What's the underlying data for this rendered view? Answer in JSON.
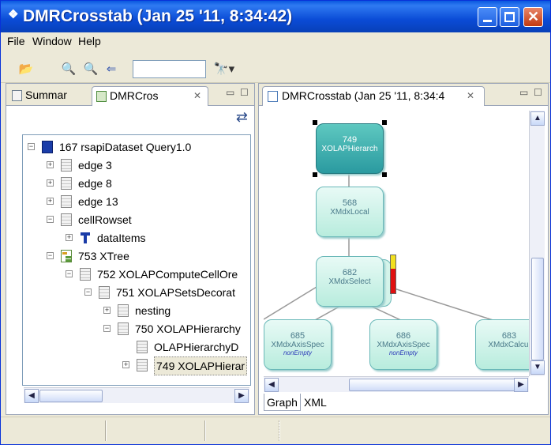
{
  "window": {
    "title": "DMRCrosstab (Jan 25 '11, 8:34:42)",
    "icon": "app-icon"
  },
  "menubar": {
    "items": [
      "File",
      "Window",
      "Help"
    ]
  },
  "toolbar": {
    "search_value": "",
    "icons": [
      "open-folder-icon",
      "zoom-in-icon",
      "zoom-out-icon",
      "back-icon",
      "find-icon"
    ]
  },
  "left_view": {
    "tabs": [
      {
        "label": "Summar",
        "icon": "summary-icon"
      },
      {
        "label": "DMRCros",
        "icon": "tree-icon",
        "active": true
      }
    ],
    "tree": [
      {
        "label": "167 rsapiDataset Query1.0",
        "level": 0,
        "expander": "−",
        "icon": "blue"
      },
      {
        "label": "edge 3",
        "level": 1,
        "expander": "+",
        "icon": "doc"
      },
      {
        "label": "edge 8",
        "level": 1,
        "expander": "+",
        "icon": "doc"
      },
      {
        "label": "edge 13",
        "level": 1,
        "expander": "+",
        "icon": "doc"
      },
      {
        "label": "cellRowset",
        "level": 1,
        "expander": "−",
        "icon": "doc"
      },
      {
        "label": "dataItems",
        "level": 2,
        "expander": "+",
        "icon": "di"
      },
      {
        "label": "753 XTree",
        "level": 1,
        "expander": "−",
        "icon": "xt"
      },
      {
        "label": "752 XOLAPComputeCellOre",
        "level": 2,
        "expander": "−",
        "icon": "doc"
      },
      {
        "label": "751 XOLAPSetsDecorat",
        "level": 3,
        "expander": "−",
        "icon": "doc"
      },
      {
        "label": "nesting",
        "level": 4,
        "expander": "+",
        "icon": "doc"
      },
      {
        "label": "750 XOLAPHierarchy",
        "level": 4,
        "expander": "−",
        "icon": "doc"
      },
      {
        "label": "OLAPHierarchyD",
        "level": 5,
        "expander": "",
        "icon": "doc"
      },
      {
        "label": "749 XOLAPHierar",
        "level": 5,
        "expander": "+",
        "icon": "doc",
        "selected": true
      }
    ]
  },
  "right_view": {
    "tab_label": "DMRCrosstab (Jan 25 '11, 8:34:4",
    "graph_nodes": [
      {
        "id": "749",
        "name": "XOLAPHierarch",
        "sub": "",
        "selected": true
      },
      {
        "id": "568",
        "name": "XMdxLocal",
        "sub": ""
      },
      {
        "id": "682",
        "name": "XMdxSelect",
        "sub": ""
      },
      {
        "id": "685",
        "name": "XMdxAxisSpec",
        "sub": "nonEmpty"
      },
      {
        "id": "686",
        "name": "XMdxAxisSpec",
        "sub": "nonEmpty"
      },
      {
        "id": "683",
        "name": "XMdxCalcul",
        "sub": ""
      }
    ],
    "bottom_tabs": [
      "Graph",
      "XML"
    ]
  }
}
